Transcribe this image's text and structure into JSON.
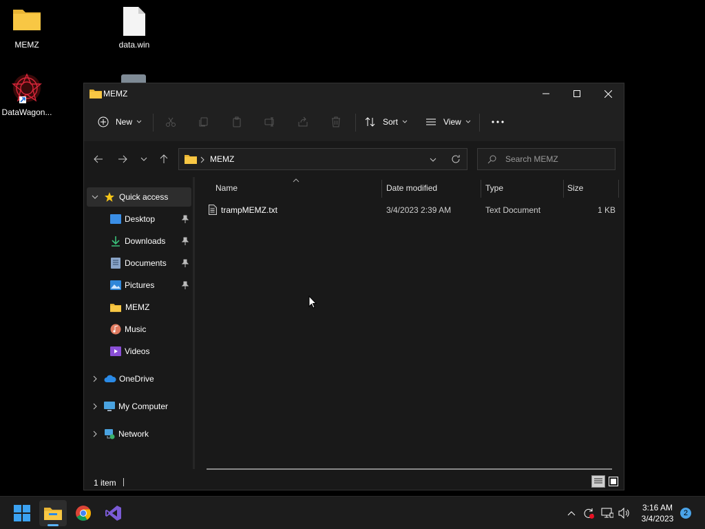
{
  "desktop": {
    "icons": [
      {
        "label": "MEMZ"
      },
      {
        "label": "data.win"
      },
      {
        "label": "DataWagon..."
      }
    ]
  },
  "window": {
    "title": "MEMZ",
    "toolbar": {
      "new_label": "New",
      "sort_label": "Sort",
      "view_label": "View"
    },
    "address": {
      "path": "MEMZ"
    },
    "search": {
      "placeholder": "Search MEMZ"
    },
    "sidebar": {
      "quick_access": "Quick access",
      "items": [
        {
          "label": "Desktop"
        },
        {
          "label": "Downloads"
        },
        {
          "label": "Documents"
        },
        {
          "label": "Pictures"
        },
        {
          "label": "MEMZ"
        },
        {
          "label": "Music"
        },
        {
          "label": "Videos"
        }
      ],
      "onedrive": "OneDrive",
      "my_computer": "My Computer",
      "network": "Network"
    },
    "columns": {
      "name": "Name",
      "date": "Date modified",
      "type": "Type",
      "size": "Size"
    },
    "files": [
      {
        "name": "trampMEMZ.txt",
        "date": "3/4/2023 2:39 AM",
        "type": "Text Document",
        "size": "1 KB"
      }
    ],
    "status": {
      "count": "1 item"
    }
  },
  "taskbar": {
    "time": "3:16 AM",
    "date": "3/4/2023",
    "notification_count": "2"
  },
  "colors": {
    "accent": "#0078d4",
    "folder": "#f8c744",
    "background": "#191919"
  }
}
